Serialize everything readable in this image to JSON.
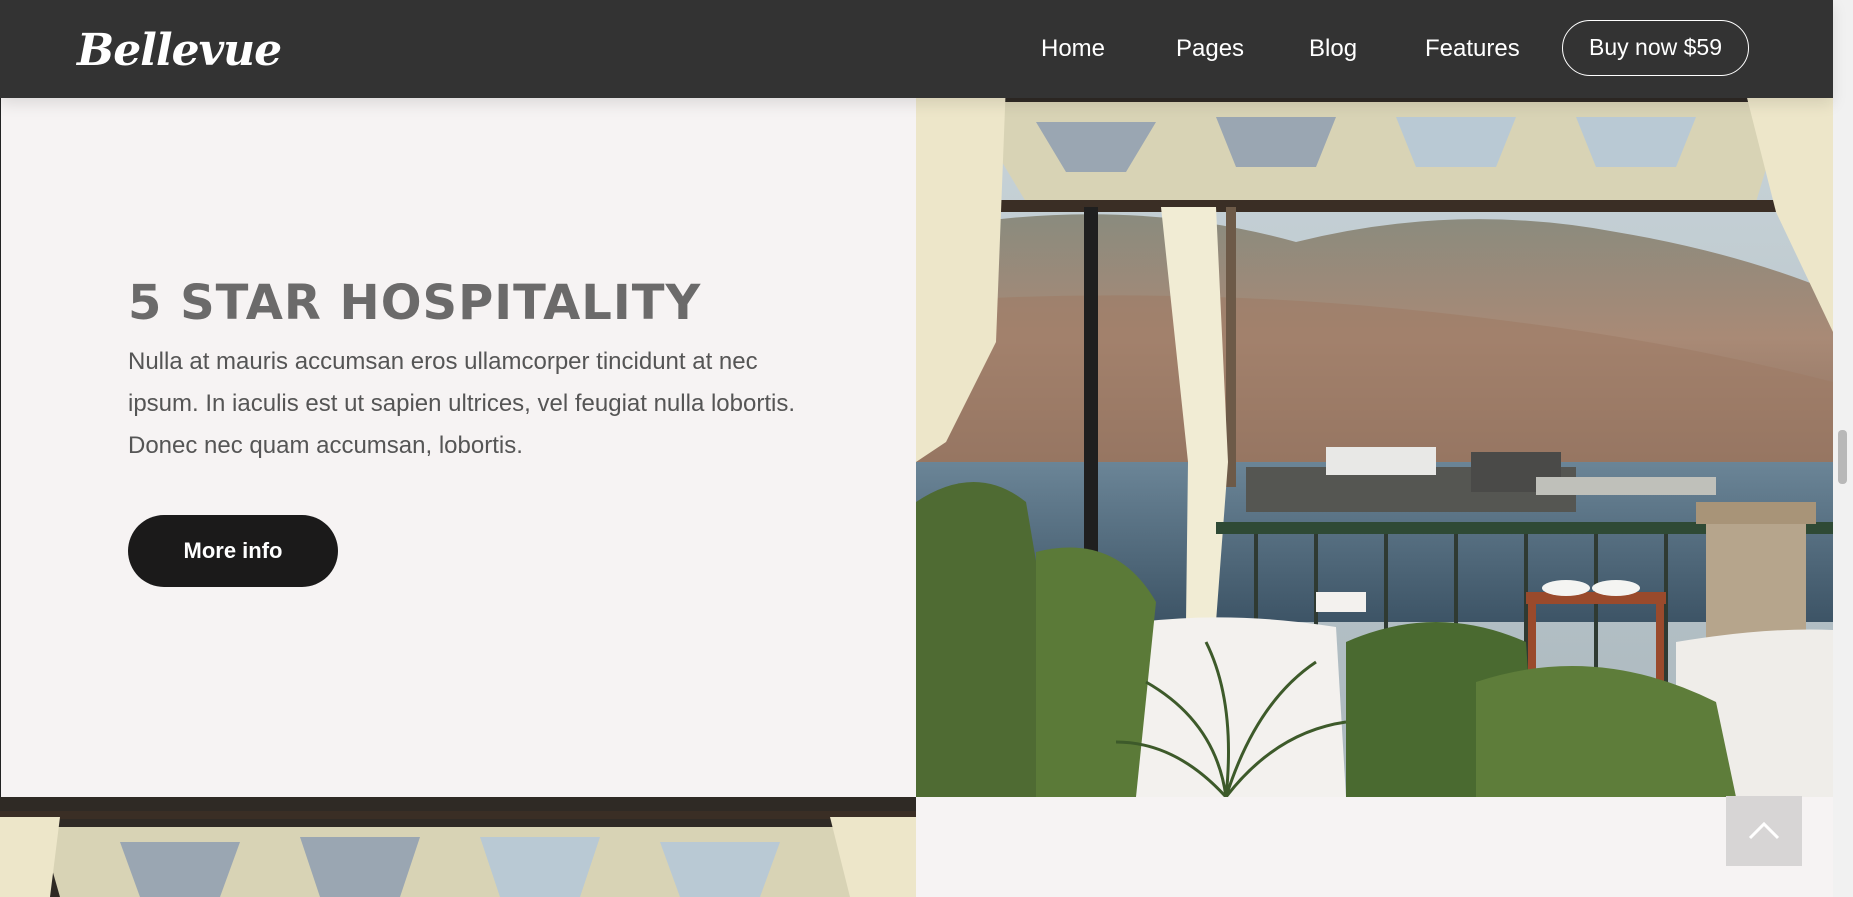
{
  "header": {
    "logo_text": "Bellevue",
    "nav": [
      {
        "label": "Home"
      },
      {
        "label": "Pages"
      },
      {
        "label": "Blog"
      },
      {
        "label": "Features"
      }
    ],
    "buy_label": "Buy now $59"
  },
  "hero": {
    "title": "5 STAR HOSPITALITY",
    "paragraph": "Nulla at mauris accumsan eros ullamcorper tincidunt at nec ipsum. In iaculis est ut sapien ultrices, vel feugiat nulla lobortis. Donec nec quam accumsan, lobortis.",
    "button_label": "More info"
  },
  "icons": {
    "scroll_top": "chevron-up-icon"
  },
  "colors": {
    "header_bg": "#333333",
    "page_bg": "#f6f3f3",
    "headline": "#6b6a6a",
    "button_dark": "#1b1a1a"
  }
}
